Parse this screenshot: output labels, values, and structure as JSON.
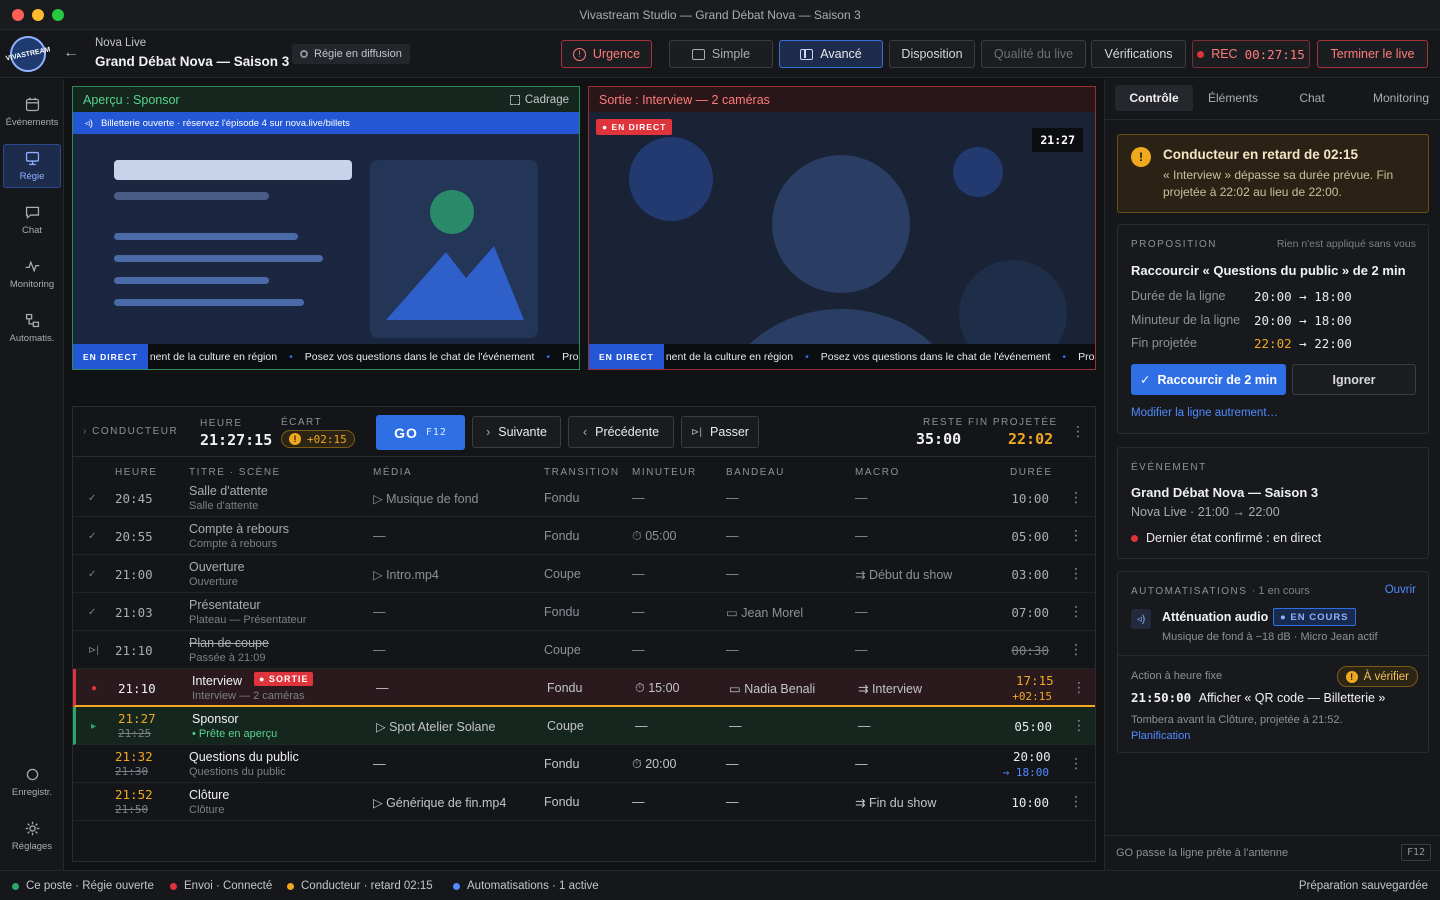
{
  "window": {
    "title": "Vivastream Studio — Grand Débat Nova — Saison 3"
  },
  "header": {
    "org": "Nova Live",
    "event_title": "Grand Débat Nova — Saison 3",
    "mode_badge": "Régie en diffusion",
    "logo_text": "VIVASTREAM",
    "urgence": "Urgence",
    "simple": "Simple",
    "avance": "Avancé",
    "disposition": "Disposition",
    "qualite": "Qualité du live",
    "verifications": "Vérifications",
    "rec_label": "REC",
    "rec_time": "00:27:15",
    "terminer": "Terminer le live"
  },
  "sidebar": {
    "items": [
      {
        "label": "Événements",
        "icon": "calendar-icon"
      },
      {
        "label": "Régie",
        "icon": "monitor-icon"
      },
      {
        "label": "Chat",
        "icon": "chat-icon"
      },
      {
        "label": "Monitoring",
        "icon": "pulse-icon"
      },
      {
        "label": "Automatis.",
        "icon": "automation-icon"
      }
    ],
    "bottom": [
      {
        "label": "Enregistr.",
        "icon": "record-icon"
      },
      {
        "label": "Réglages",
        "icon": "gear-icon"
      }
    ]
  },
  "preview": {
    "title": "Aperçu : Sponsor",
    "cadrage": "Cadrage",
    "banner": "Billetterie ouverte · réservez l'épisode 4 sur nova.live/billets",
    "ticker_tag": "EN DIRECT",
    "ticker_text": "nent de la culture en région",
    "ticker_text2": "Posez vos questions dans le chat de l'événement",
    "ticker_text3": "Pro"
  },
  "output": {
    "title": "Sortie : Interview — 2 caméras",
    "live_badge": "● EN DIRECT",
    "clock": "21:27",
    "ticker_tag": "EN DIRECT",
    "ticker_text": "nent de la culture en région",
    "ticker_text2": "Posez vos questions dans le chat de l'événement",
    "ticker_text3": "Pro"
  },
  "rundown": {
    "label": "CONDUCTEUR",
    "heure_label": "HEURE",
    "heure": "21:27:15",
    "ecart_label": "ÉCART",
    "ecart": "+02:15",
    "go": "GO",
    "go_key": "F12",
    "suivante": "Suivante",
    "precedente": "Précédente",
    "passer": "Passer",
    "reste_label": "RESTE",
    "reste": "35:00",
    "fin_label": "FIN PROJETÉE",
    "fin": "22:02",
    "columns": {
      "heure": "HEURE",
      "titre": "TITRE · SCÈNE",
      "media": "MÉDIA",
      "transition": "TRANSITION",
      "minuteur": "MINUTEUR",
      "bandeau": "BANDEAU",
      "macro": "MACRO",
      "duree": "DURÉE"
    },
    "rows": [
      {
        "status": "✓",
        "time": "20:45",
        "title": "Salle d'attente",
        "scene": "Salle d'attente",
        "media": "▷ Musique de fond",
        "transition": "Fondu",
        "timer": "—",
        "bandeau": "—",
        "macro": "—",
        "duration": "10:00"
      },
      {
        "status": "✓",
        "time": "20:55",
        "title": "Compte à rebours",
        "scene": "Compte à rebours",
        "media": "—",
        "transition": "Fondu",
        "timer": "⏱ 05:00",
        "bandeau": "—",
        "macro": "—",
        "duration": "05:00"
      },
      {
        "status": "✓",
        "time": "21:00",
        "title": "Ouverture",
        "scene": "Ouverture",
        "media": "▷ Intro.mp4",
        "transition": "Coupe",
        "timer": "—",
        "bandeau": "—",
        "macro": "⇉ Début du show",
        "duration": "03:00"
      },
      {
        "status": "✓",
        "time": "21:03",
        "title": "Présentateur",
        "scene": "Plateau — Présentateur",
        "media": "—",
        "transition": "Fondu",
        "timer": "—",
        "bandeau": "▭ Jean Morel",
        "macro": "—",
        "duration": "07:00"
      },
      {
        "status": "⊳|",
        "time": "21:10",
        "title": "Plan de coupe",
        "scene": "Passée à 21:09",
        "media": "—",
        "transition": "Coupe",
        "timer": "—",
        "bandeau": "—",
        "macro": "—",
        "duration": "00:30"
      },
      {
        "status": "●",
        "time": "21:10",
        "title": "Interview",
        "badge": "● SORTIE",
        "scene": "Interview — 2 caméras",
        "media": "—",
        "transition": "Fondu",
        "timer": "⏱ 15:00",
        "bandeau": "▭ Nadia Benali",
        "macro": "⇉ Interview",
        "duration": "17:15",
        "duration2": "+02:15"
      },
      {
        "status": "▸",
        "time": "21:27",
        "time_old": "21:25",
        "title": "Sponsor",
        "scene": "• Prête en aperçu",
        "media": "▷ Spot Atelier Solane",
        "transition": "Coupe",
        "timer": "—",
        "bandeau": "—",
        "macro": "—",
        "duration": "05:00"
      },
      {
        "status": "",
        "time": "21:32",
        "time_old": "21:30",
        "title": "Questions du public",
        "scene": "Questions du public",
        "media": "—",
        "transition": "Fondu",
        "timer": "⏱ 20:00",
        "bandeau": "—",
        "macro": "—",
        "duration": "20:00",
        "duration2": "→ 18:00"
      },
      {
        "status": "",
        "time": "21:52",
        "time_old": "21:50",
        "title": "Clôture",
        "scene": "Clôture",
        "media": "▷ Générique de fin.mp4",
        "transition": "Fondu",
        "timer": "—",
        "bandeau": "—",
        "macro": "⇉ Fin du show",
        "duration": "10:00"
      }
    ]
  },
  "right": {
    "tabs": [
      "Contrôle",
      "Éléments",
      "Chat",
      "Monitoring"
    ],
    "alert": {
      "title": "Conducteur en retard de 02:15",
      "text1": "« Interview » dépasse sa durée prévue. Fin",
      "text2": "projetée à 22:02 au lieu de 22:00."
    },
    "proposal": {
      "label": "PROPOSITION",
      "note": "Rien n'est appliqué sans vous",
      "title": "Raccourcir « Questions du public » de 2 min",
      "k1": "Durée de la ligne",
      "v1": "20:00 → 18:00",
      "k2": "Minuteur de la ligne",
      "v2": "20:00 → 18:00",
      "k3": "Fin projetée",
      "v3a": "22:02",
      "v3b": "→ 22:00",
      "apply": "Raccourcir de 2 min",
      "ignore": "Ignorer",
      "modify": "Modifier la ligne autrement…"
    },
    "event": {
      "label": "ÉVÉNEMENT",
      "title": "Grand Débat Nova — Saison 3",
      "sub": "Nova Live · 21:00 → 22:00",
      "state": "Dernier état confirmé : en direct"
    },
    "auto": {
      "label": "AUTOMATISATIONS",
      "count": "· 1 en cours",
      "open": "Ouvrir",
      "item_title": "Atténuation audio",
      "item_badge": "● EN COURS",
      "item_sub": "Musique de fond à −18 dB · Micro Jean actif",
      "fixed_label": "Action à heure fixe",
      "verify": "À vérifier",
      "fixed_time": "21:50:00",
      "fixed_action": "Afficher « QR code — Billetterie »",
      "fixed_note": "Tombera avant la Clôture, projetée à 21:52.",
      "planif": "Planification"
    },
    "footer": {
      "text": "GO passe la ligne prête à l'antenne",
      "key": "F12"
    }
  },
  "status": {
    "s1": "Ce poste · Régie ouverte",
    "s2": "Envoi · Connecté",
    "s3": "Conducteur · retard 02:15",
    "s4": "Automatisations · 1 active",
    "right": "Préparation sauvegardée"
  },
  "colors": {
    "accent": "#2f6fe6",
    "live": "#e0343d",
    "warn": "#f0a81f",
    "preview": "#29a86a"
  }
}
